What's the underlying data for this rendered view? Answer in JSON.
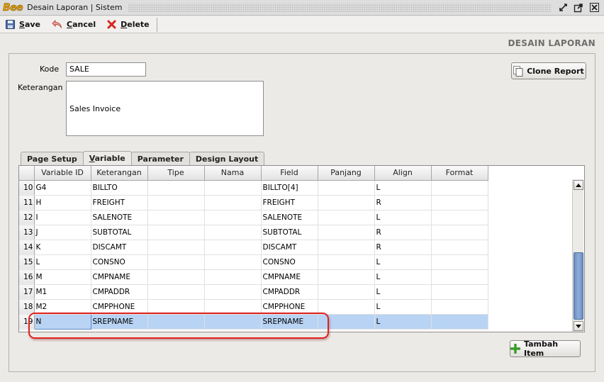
{
  "window": {
    "logo": "Bee",
    "title": "Desain Laporan | Sistem",
    "buttons": [
      "restore-icon",
      "maximize-icon",
      "close-icon"
    ]
  },
  "toolbar": {
    "save_label": "Save",
    "cancel_label": "Cancel",
    "delete_label": "Delete"
  },
  "page": {
    "title": "DESAIN LAPORAN"
  },
  "form": {
    "kode_label": "Kode",
    "kode_value": "SALE",
    "keterangan_label": "Keterangan",
    "keterangan_value": "Sales Invoice",
    "clone_label": "Clone Report"
  },
  "tabs": [
    {
      "label": "Page Setup",
      "active": false
    },
    {
      "label": "Variable",
      "active": true
    },
    {
      "label": "Parameter",
      "active": false
    },
    {
      "label": "Design Layout",
      "active": false
    }
  ],
  "grid": {
    "columns": [
      "Variable ID",
      "Keterangan",
      "Tipe",
      "Nama",
      "Field",
      "Panjang",
      "Align",
      "Format"
    ],
    "rows": [
      {
        "no": "10",
        "id": "G4",
        "ket": "BILLTO",
        "tipe": "",
        "nama": "",
        "field": "BILLTO[4]",
        "panjang": "",
        "align": "L",
        "format": ""
      },
      {
        "no": "11",
        "id": "H",
        "ket": "FREIGHT",
        "tipe": "",
        "nama": "",
        "field": "FREIGHT",
        "panjang": "",
        "align": "R",
        "format": ""
      },
      {
        "no": "12",
        "id": "I",
        "ket": "SALENOTE",
        "tipe": "",
        "nama": "",
        "field": "SALENOTE",
        "panjang": "",
        "align": "L",
        "format": ""
      },
      {
        "no": "13",
        "id": "J",
        "ket": "SUBTOTAL",
        "tipe": "",
        "nama": "",
        "field": "SUBTOTAL",
        "panjang": "",
        "align": "R",
        "format": ""
      },
      {
        "no": "14",
        "id": "K",
        "ket": "DISCAMT",
        "tipe": "",
        "nama": "",
        "field": "DISCAMT",
        "panjang": "",
        "align": "R",
        "format": ""
      },
      {
        "no": "15",
        "id": "L",
        "ket": "CONSNO",
        "tipe": "",
        "nama": "",
        "field": "CONSNO",
        "panjang": "",
        "align": "L",
        "format": ""
      },
      {
        "no": "16",
        "id": "M",
        "ket": "CMPNAME",
        "tipe": "",
        "nama": "",
        "field": "CMPNAME",
        "panjang": "",
        "align": "L",
        "format": ""
      },
      {
        "no": "17",
        "id": "M1",
        "ket": "CMPADDR",
        "tipe": "",
        "nama": "",
        "field": "CMPADDR",
        "panjang": "",
        "align": "L",
        "format": ""
      },
      {
        "no": "18",
        "id": "M2",
        "ket": "CMPPHONE",
        "tipe": "",
        "nama": "",
        "field": "CMPPHONE",
        "panjang": "",
        "align": "L",
        "format": ""
      },
      {
        "no": "19",
        "id": "N",
        "ket": "SREPNAME",
        "tipe": "",
        "nama": "",
        "field": "SREPNAME",
        "panjang": "",
        "align": "L",
        "format": "",
        "selected": true
      }
    ]
  },
  "add_item_label": "Tambah Item",
  "colors": {
    "selection": "#b8d3f4",
    "annotation": "#e0221d",
    "scroll_thumb": "#7c9ccb"
  }
}
